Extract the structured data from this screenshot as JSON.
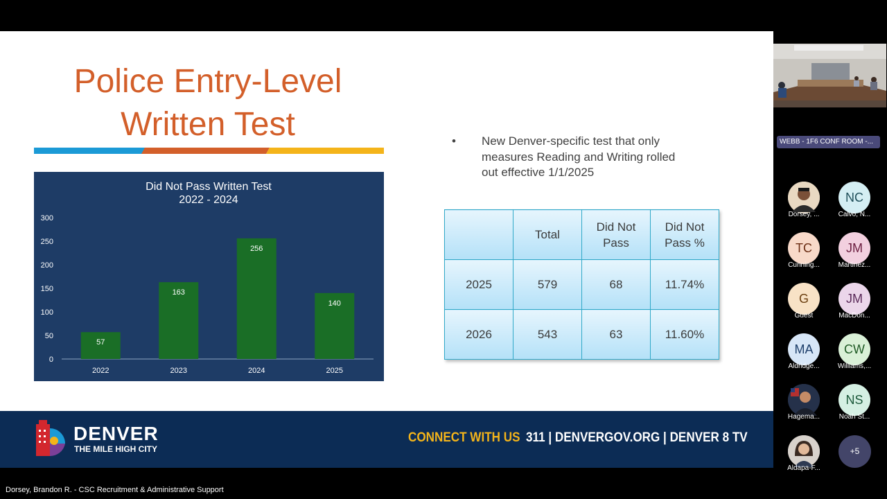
{
  "slide": {
    "title_line1": "Police Entry-Level",
    "title_line2": "Written Test",
    "title_color": "#d35f2a",
    "bullet": "New Denver-specific test that only measures Reading and Writing rolled out effective 1/1/2025",
    "table": {
      "headers": [
        "",
        "Total",
        "Did Not Pass",
        "Did Not Pass %"
      ],
      "rows": [
        [
          "2025",
          "579",
          "68",
          "11.74%"
        ],
        [
          "2026",
          "543",
          "63",
          "11.60%"
        ]
      ]
    },
    "footer": {
      "brand": "DENVER",
      "tagline": "THE MILE HIGH CITY",
      "connect": "CONNECT WITH US",
      "contacts": "311 | DENVERGOV.ORG | DENVER 8 TV"
    }
  },
  "chart_data": {
    "type": "bar",
    "title": "Did Not Pass Written Test",
    "subtitle": "2022 - 2024",
    "categories": [
      "2022",
      "2023",
      "2024",
      "2025"
    ],
    "values": [
      57,
      163,
      256,
      140
    ],
    "ylim": [
      0,
      300
    ],
    "yticks": [
      0,
      50,
      100,
      150,
      200,
      250,
      300
    ],
    "bar_color": "#1a6e26",
    "background": "#1e3c66",
    "grid": false
  },
  "meeting": {
    "room_label": "WEBB - 1F6 CONF ROOM -...",
    "participants": [
      {
        "initials": "",
        "name": "Dorsey, ...",
        "photo": true,
        "bg": "#e9d9c2",
        "fg": "#1b1b1b"
      },
      {
        "initials": "NC",
        "name": "Calvo, N...",
        "photo": false,
        "bg": "#d4eef3",
        "fg": "#1f4f5a"
      },
      {
        "initials": "TC",
        "name": "Cunning...",
        "photo": false,
        "bg": "#f8d9c9",
        "fg": "#6b2d14"
      },
      {
        "initials": "JM",
        "name": "Martinez...",
        "photo": false,
        "bg": "#f2d0df",
        "fg": "#6b1d3f"
      },
      {
        "initials": "G",
        "name": "Guest",
        "photo": false,
        "bg": "#f8e2c6",
        "fg": "#6b3f10"
      },
      {
        "initials": "JM",
        "name": "MacDon...",
        "photo": false,
        "bg": "#ebd6ea",
        "fg": "#5b2a5a"
      },
      {
        "initials": "MA",
        "name": "Aldridge...",
        "photo": false,
        "bg": "#d7e6f7",
        "fg": "#1d3e6a"
      },
      {
        "initials": "CW",
        "name": "Williams,...",
        "photo": false,
        "bg": "#d9f0d7",
        "fg": "#1f5a25"
      },
      {
        "initials": "",
        "name": "Hagema...",
        "photo": true,
        "bg": "#25314a",
        "fg": "#fff"
      },
      {
        "initials": "NS",
        "name": "Noah St...",
        "photo": false,
        "bg": "#d5f0e3",
        "fg": "#1d5a3b"
      },
      {
        "initials": "",
        "name": "Aldapa-F...",
        "photo": true,
        "bg": "#d8d2cc",
        "fg": "#333"
      }
    ],
    "more_count": "+5",
    "presenter": "Dorsey, Brandon R. - CSC Recruitment & Administrative Support"
  }
}
